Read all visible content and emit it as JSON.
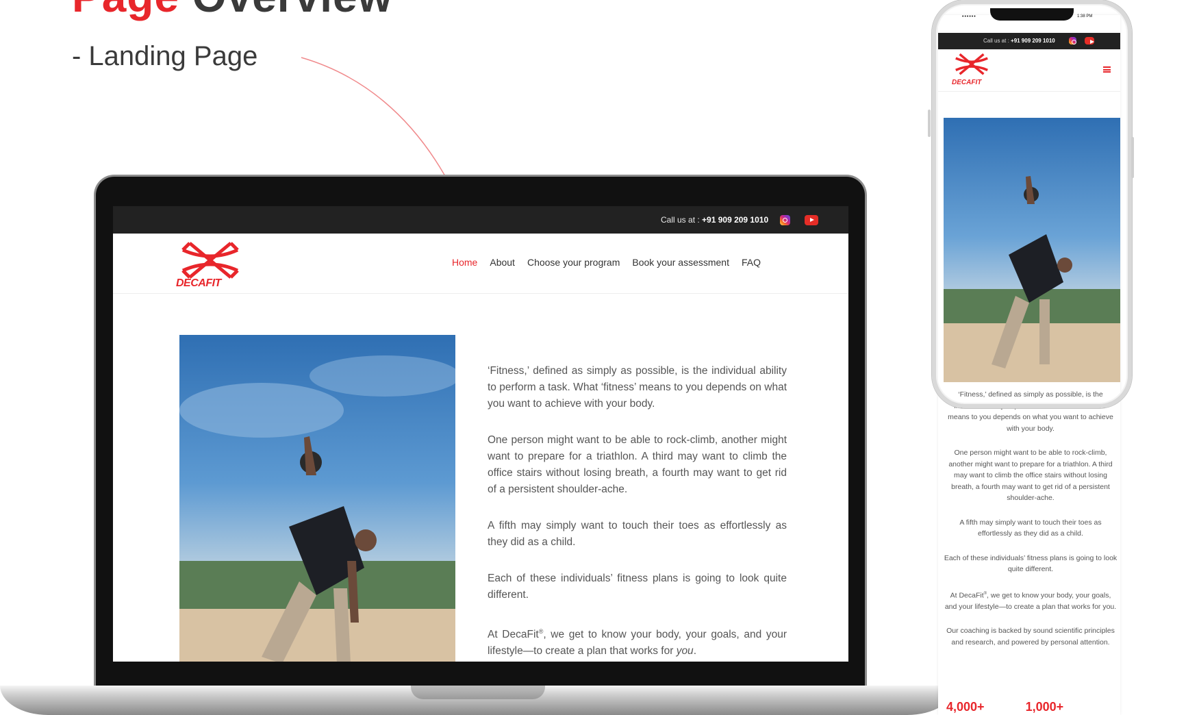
{
  "heading": {
    "accent": "Page",
    "rest": "Overview",
    "subtitle": "- Landing Page"
  },
  "colors": {
    "accent": "#e8262b",
    "topbar": "#222222",
    "text": "#555555"
  },
  "site": {
    "topbar": {
      "call_label": "Call us at : ",
      "phone": "+91 909 209 1010",
      "icons": [
        "instagram-icon",
        "youtube-icon"
      ]
    },
    "brand": "DECAFIT",
    "nav": [
      "Home",
      "About",
      "Choose your program",
      "Book your assessment",
      "FAQ"
    ],
    "active_nav": "Home",
    "paragraphs": [
      "‘Fitness,’ defined as simply as possible, is the individual ability to perform a task. What ‘fitness’ means to you depends on what you want to achieve with your body.",
      "One person might want to be able to rock-climb, another might want to prepare for a triathlon. A third may want to climb the office stairs without losing breath, a fourth may want to get rid of a persistent shoulder-ache.",
      "A fifth may simply want to touch their toes as effortlessly as they did as a child.",
      "Each of these individuals’ fitness plans is going to look quite different."
    ],
    "last_paragraph": {
      "before": "At DecaFit",
      "mark": "®",
      "middle": ", we get to know your body, your goals, and your lifestyle—to create a plan that works for ",
      "emph": "you",
      "after": "."
    }
  },
  "phone": {
    "status_left": "••••••",
    "status_right": "1:38 PM",
    "topbar": {
      "call_label": "Call us at : ",
      "phone": "+91 909 209 1010"
    },
    "brand": "DECAFIT",
    "paragraphs": [
      "‘Fitness,’ defined as simply as possible, is the individual ability to perform a task. What ‘fitness’ means to you depends on what you want to achieve with your body.",
      "One person might want to be able to rock-climb, another might want to prepare for a triathlon. A third may want to climb the office stairs without losing breath, a fourth may want to get rid of a persistent shoulder-ache.",
      "A fifth may simply want to touch their toes as effortlessly as they did as a child.",
      "Each of these individuals’ fitness plans is going to look quite different."
    ],
    "last_paragraph": {
      "before": "At DecaFit",
      "mark": "®",
      "after": ", we get to know your body, your goals, and your lifestyle—to create a plan that works for you."
    },
    "coaching": "Our coaching is backed by sound scientific principles and research, and powered by personal attention.",
    "stats": [
      "4,000+",
      "1,000+"
    ]
  }
}
